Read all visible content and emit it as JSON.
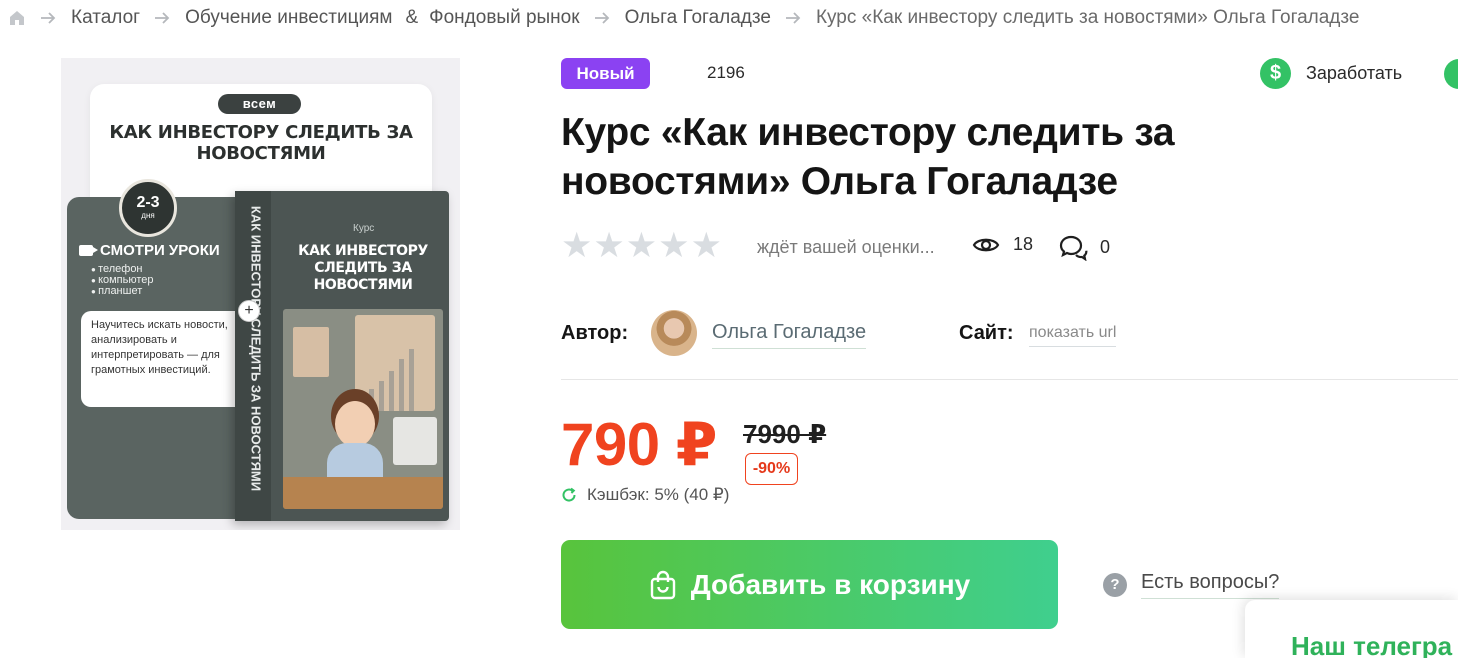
{
  "breadcrumb": {
    "items": [
      "Каталог",
      "Обучение инвестициям",
      "Фондовый рынок",
      "Ольга Гогаладзе"
    ],
    "amp": "&",
    "current": "Курс «Как инвестору следить за новостями» Ольга Гогаладзе"
  },
  "product_image": {
    "pill": "всем",
    "title": "КАК ИНВЕСТОРУ СЛЕДИТЬ ЗА НОВОСТЯМИ",
    "badge_big": "2-3",
    "badge_small": "дня",
    "watch": "СМОТРИ УРОКИ",
    "devices": [
      "телефон",
      "компьютер",
      "планшет"
    ],
    "info": "Научитесь искать новости, анализировать и интерпретировать — для грамотных инвестиций.",
    "box_label": "Курс",
    "box_title": "КАК ИНВЕСТОРУ СЛЕДИТЬ ЗА НОВОСТЯМИ",
    "box_spine": "КАК ИНВЕСТОРУ СЛЕДИТЬ ЗА НОВОСТЯМИ"
  },
  "badge": "Новый",
  "count": "2196",
  "earn_label": "Заработать",
  "title": "Курс «Как инвестору следить за новостями» Ольга Гогаладзе",
  "rating": {
    "stars_total": 5,
    "stars_filled": 0,
    "text": "ждёт вашей оценки..."
  },
  "views": "18",
  "comments": "0",
  "author": {
    "label": "Автор:",
    "name": "Ольга Гогаладзе"
  },
  "site": {
    "label": "Сайт:",
    "link": "показать url"
  },
  "price": {
    "current": "790 ₽",
    "old": "7990 ₽",
    "discount": "-90%",
    "cashback": "Кэшбэк: 5% (40 ₽)"
  },
  "cart_button": "Добавить в корзину",
  "questions": "Есть вопросы?",
  "telegram_panel": "Наш телегра",
  "colors": {
    "accent_green": "#33c265",
    "price_red": "#f0431f",
    "badge_purple": "#8b42f2",
    "star_empty": "#d9dde1"
  },
  "icons": {
    "home": "home-icon",
    "separator": "arrow-right-icon",
    "earn": "dollar-icon",
    "views": "eye-icon",
    "comments": "chat-icon",
    "cashback": "refresh-icon",
    "cart": "shopping-bag-icon",
    "questions": "question-icon"
  }
}
